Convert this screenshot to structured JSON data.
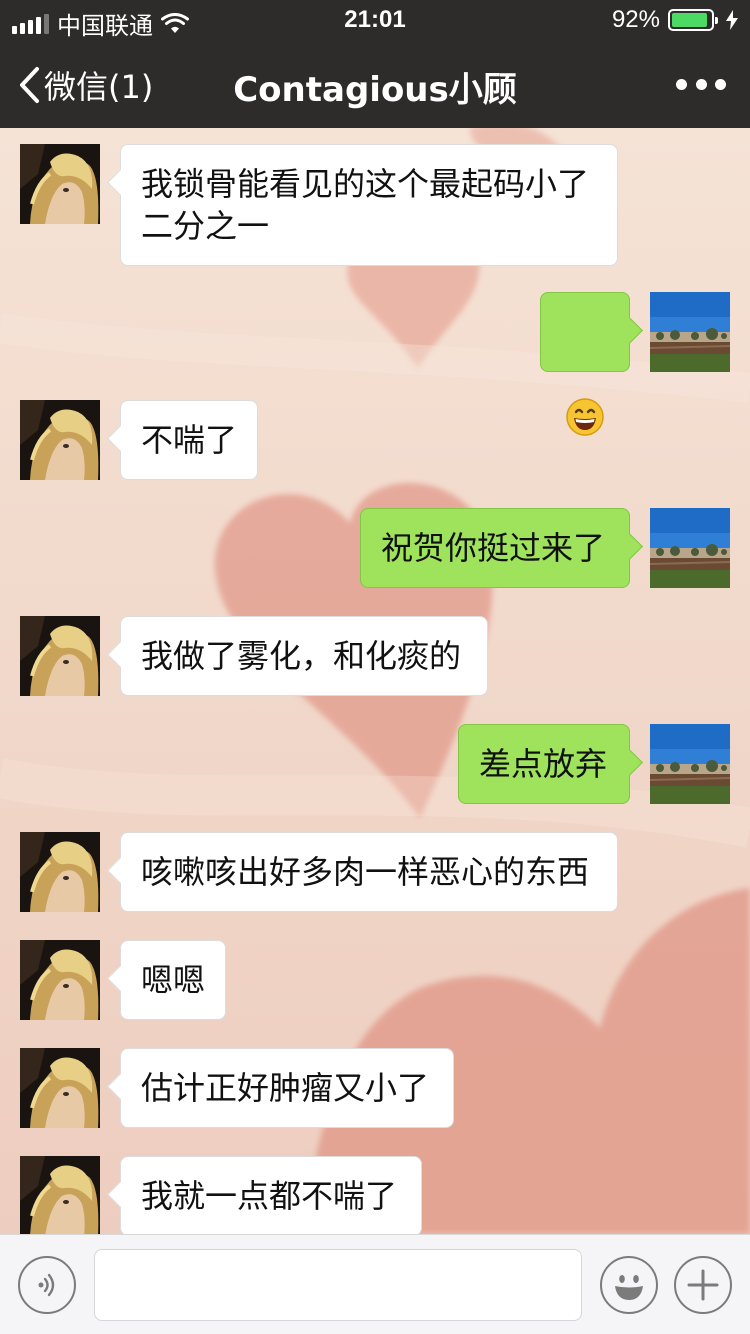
{
  "status_bar": {
    "carrier": "中国联通",
    "time": "21:01",
    "battery_percent": "92%",
    "battery_level": 0.92,
    "signal_icon": "signal-bars-icon",
    "wifi_icon": "wifi-icon",
    "charging_icon": "charging-bolt-icon"
  },
  "nav": {
    "back_label": "微信(1)",
    "title": "Contagious小顾",
    "more_icon": "more-dots-icon"
  },
  "messages": [
    {
      "side": "in",
      "text": "我锁骨能看见的这个最起码小了\n二分之一"
    },
    {
      "side": "out",
      "text": "😄",
      "emoji": "grinning-face"
    },
    {
      "side": "in",
      "text": "不喘了"
    },
    {
      "side": "out",
      "text": "祝贺你挺过来了"
    },
    {
      "side": "in",
      "text": "我做了雾化，和化痰的"
    },
    {
      "side": "out",
      "text": "差点放弃"
    },
    {
      "side": "in",
      "text": "咳嗽咳出好多肉一样恶心的东西"
    },
    {
      "side": "in",
      "text": "嗯嗯"
    },
    {
      "side": "in",
      "text": "估计正好肿瘤又小了"
    },
    {
      "side": "in",
      "text": "我就一点都不喘了"
    }
  ],
  "input_bar": {
    "voice_icon": "voice-icon",
    "text_value": "",
    "emoji_icon": "emoji-icon",
    "add_icon": "plus-icon"
  },
  "colors": {
    "nav_bg": "#2e2b2b",
    "bubble_out": "#9fe25c",
    "bubble_in": "#ffffff",
    "battery": "#4cd964",
    "wallpaper": "#f3ddd0"
  }
}
